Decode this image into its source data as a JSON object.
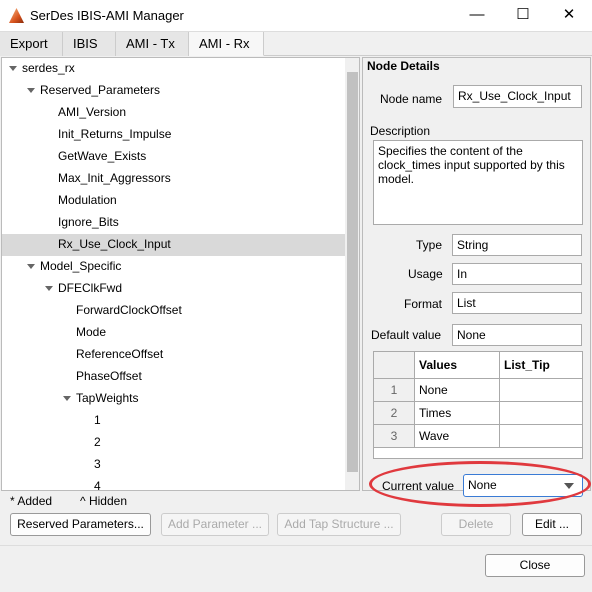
{
  "window": {
    "title": "SerDes IBIS-AMI Manager",
    "minimize": "—",
    "maximize": "☐",
    "close": "✕"
  },
  "tabs": [
    {
      "label": "Export"
    },
    {
      "label": "IBIS"
    },
    {
      "label": "AMI - Tx"
    },
    {
      "label": "AMI - Rx",
      "active": true
    }
  ],
  "tree": {
    "items": [
      {
        "label": "serdes_rx",
        "level": 0,
        "expanded": true
      },
      {
        "label": "Reserved_Parameters",
        "level": 1,
        "expanded": true
      },
      {
        "label": "AMI_Version",
        "level": 2
      },
      {
        "label": "Init_Returns_Impulse",
        "level": 2
      },
      {
        "label": "GetWave_Exists",
        "level": 2
      },
      {
        "label": "Max_Init_Aggressors",
        "level": 2
      },
      {
        "label": "Modulation",
        "level": 2
      },
      {
        "label": "Ignore_Bits",
        "level": 2
      },
      {
        "label": "Rx_Use_Clock_Input",
        "level": 2,
        "selected": true
      },
      {
        "label": "Model_Specific",
        "level": 1,
        "expanded": true
      },
      {
        "label": "DFEClkFwd",
        "level": 2,
        "expanded": true
      },
      {
        "label": "ForwardClockOffset",
        "level": 3
      },
      {
        "label": "Mode",
        "level": 3
      },
      {
        "label": "ReferenceOffset",
        "level": 3
      },
      {
        "label": "PhaseOffset",
        "level": 3
      },
      {
        "label": "TapWeights",
        "level": 3,
        "expanded": true
      },
      {
        "label": "1",
        "level": 4
      },
      {
        "label": "2",
        "level": 4
      },
      {
        "label": "3",
        "level": 4
      },
      {
        "label": "4",
        "level": 4
      }
    ]
  },
  "details": {
    "header": "Node Details",
    "node_name_label": "Node name",
    "node_name": "Rx_Use_Clock_Input",
    "description_label": "Description",
    "description": "Specifies the content of the clock_times input supported by this model.",
    "type_label": "Type",
    "type": "String",
    "usage_label": "Usage",
    "usage": "In",
    "format_label": "Format",
    "format": "List",
    "default_label": "Default value",
    "default": "None",
    "table": {
      "headers": [
        "",
        "Values",
        "List_Tip"
      ],
      "rows": [
        [
          "1",
          "None",
          ""
        ],
        [
          "2",
          "Times",
          ""
        ],
        [
          "3",
          "Wave",
          ""
        ]
      ]
    },
    "current_value_label": "Current value",
    "current_value": "None",
    "highlight_color": "#e0393e"
  },
  "legend": {
    "added": "* Added",
    "hidden": "^ Hidden"
  },
  "buttons": {
    "reserved": "Reserved Parameters...",
    "add_param": "Add Parameter ...",
    "add_tap": "Add Tap Structure ...",
    "delete": "Delete",
    "edit": "Edit ...",
    "close": "Close"
  }
}
